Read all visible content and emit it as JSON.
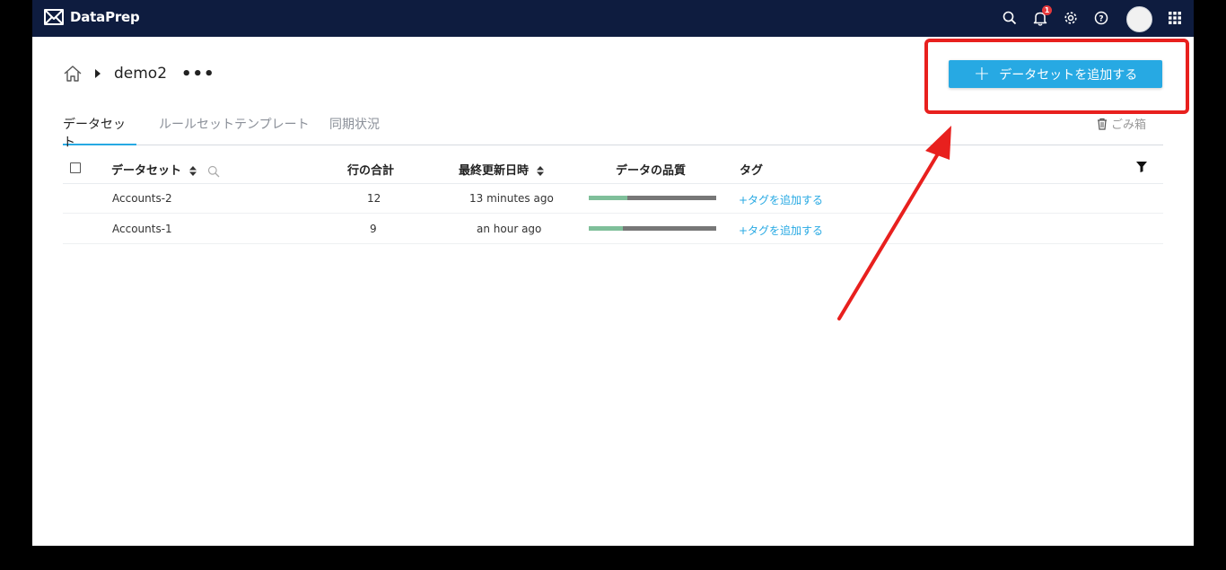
{
  "app": {
    "name": "DataPrep",
    "notification_count": "1"
  },
  "breadcrumb": {
    "project": "demo2",
    "more": "•••"
  },
  "actions": {
    "add_dataset": "データセットを追加する",
    "plus": "+"
  },
  "tabs": [
    {
      "label": "データセット",
      "active": true
    },
    {
      "label": "ルールセットテンプレート",
      "active": false
    },
    {
      "label": "同期状況",
      "active": false
    }
  ],
  "trash": {
    "label": "ごみ箱"
  },
  "table": {
    "columns": {
      "dataset": "データセット",
      "rows": "行の合計",
      "last_updated": "最終更新日時",
      "quality": "データの品質",
      "tags": "タグ"
    },
    "rows": [
      {
        "dataset": "Accounts-2",
        "rows": "12",
        "last_updated": "13 minutes ago",
        "quality_good": 0.3,
        "tags": "+タグを追加する"
      },
      {
        "dataset": "Accounts-1",
        "rows": "9",
        "last_updated": "an hour ago",
        "quality_good": 0.27,
        "tags": "+タグを追加する"
      }
    ]
  },
  "colors": {
    "topbar": "#0e1c3f",
    "accent": "#27a9e3",
    "annotation": "#e8201e",
    "quality_good": "#7fbf9a",
    "quality_bad": "#777777"
  },
  "icons": [
    "logo-icon",
    "search-icon",
    "bell-icon",
    "gear-icon",
    "help-icon",
    "apps-grid-icon",
    "home-icon",
    "caret-right-icon",
    "trash-icon",
    "filter-icon"
  ]
}
